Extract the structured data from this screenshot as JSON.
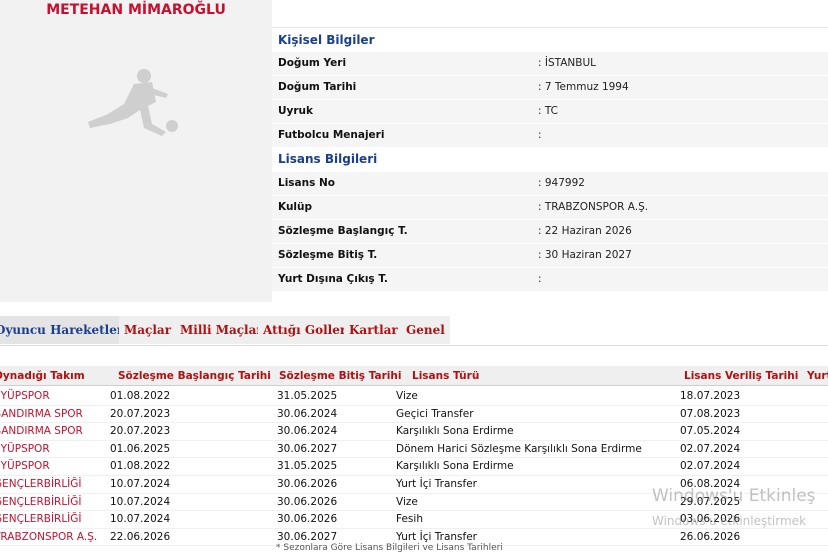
{
  "player": {
    "name": "METEHAN MİMAROĞLU"
  },
  "personal": {
    "title": "Kişisel Bilgiler",
    "rows": [
      {
        "label": "Doğum Yeri",
        "value": ": İSTANBUL"
      },
      {
        "label": "Doğum Tarihi",
        "value": ": 7 Temmuz 1994"
      },
      {
        "label": "Uyruk",
        "value": ": TC"
      },
      {
        "label": "Futbolcu Menajeri",
        "value": ":"
      }
    ]
  },
  "license": {
    "title": "Lisans Bilgileri",
    "rows": [
      {
        "label": "Lisans No",
        "value": ": 947992"
      },
      {
        "label": "Kulüp",
        "value": ": TRABZONSPOR A.Ş."
      },
      {
        "label": "Sözleşme Başlangıç T.",
        "value": ": 22 Haziran 2026"
      },
      {
        "label": "Sözleşme Bitiş T.",
        "value": ": 30 Haziran 2027"
      },
      {
        "label": "Yurt Dışına Çıkış T.",
        "value": ":"
      }
    ]
  },
  "tabs": [
    {
      "label": "Oyuncu Hareketleri",
      "active": true
    },
    {
      "label": "Maçlar",
      "active": false
    },
    {
      "label": "Milli Maçlar",
      "active": false
    },
    {
      "label": "Attığı Goller",
      "active": false
    },
    {
      "label": "Kartlar",
      "active": false
    },
    {
      "label": "Genel",
      "active": false
    }
  ],
  "table": {
    "columns": [
      "Oynadığı Takım",
      "Sözleşme Başlangıç Tarihi",
      "Sözleşme Bitiş Tarihi",
      "Lisans Türü",
      "Lisans Veriliş Tarihi",
      "Yurt"
    ],
    "rows": [
      [
        "EYÜPSPOR",
        "01.08.2022",
        "31.05.2025",
        "Vize",
        "18.07.2023"
      ],
      [
        "BANDIRMA SPOR",
        "20.07.2023",
        "30.06.2024",
        "Geçici Transfer",
        "07.08.2023"
      ],
      [
        "BANDIRMA SPOR",
        "20.07.2023",
        "30.06.2024",
        "Karşılıklı Sona Erdirme",
        "07.05.2024"
      ],
      [
        "EYÜPSPOR",
        "01.06.2025",
        "30.06.2027",
        "Dönem Harici Sözleşme Karşılıklı Sona Erdirme",
        "02.07.2024"
      ],
      [
        "EYÜPSPOR",
        "01.08.2022",
        "31.05.2025",
        "Karşılıklı Sona Erdirme",
        "02.07.2024"
      ],
      [
        "GENÇLERBİRLİĞİ",
        "10.07.2024",
        "30.06.2026",
        "Yurt İçi Transfer",
        "06.08.2024"
      ],
      [
        "GENÇLERBİRLİĞİ",
        "10.07.2024",
        "30.06.2026",
        "Vize",
        "29.07.2025"
      ],
      [
        "GENÇLERBİRLİĞİ",
        "10.07.2024",
        "30.06.2026",
        "Fesih",
        "03.06.2026"
      ],
      [
        "TRABZONSPOR A.Ş.",
        "22.06.2026",
        "30.06.2027",
        "Yurt İçi Transfer",
        "26.06.2026"
      ]
    ]
  },
  "footer_note": "* Sezonlara Göre Lisans Bilgileri ve Lisans Tarihleri",
  "watermark": {
    "line1": "Windows'u Etkinleş",
    "line2": "Windows'u etkinleştirmek"
  },
  "colors": {
    "accent_red": "#c8102e",
    "section_blue": "#1a3f8f"
  }
}
